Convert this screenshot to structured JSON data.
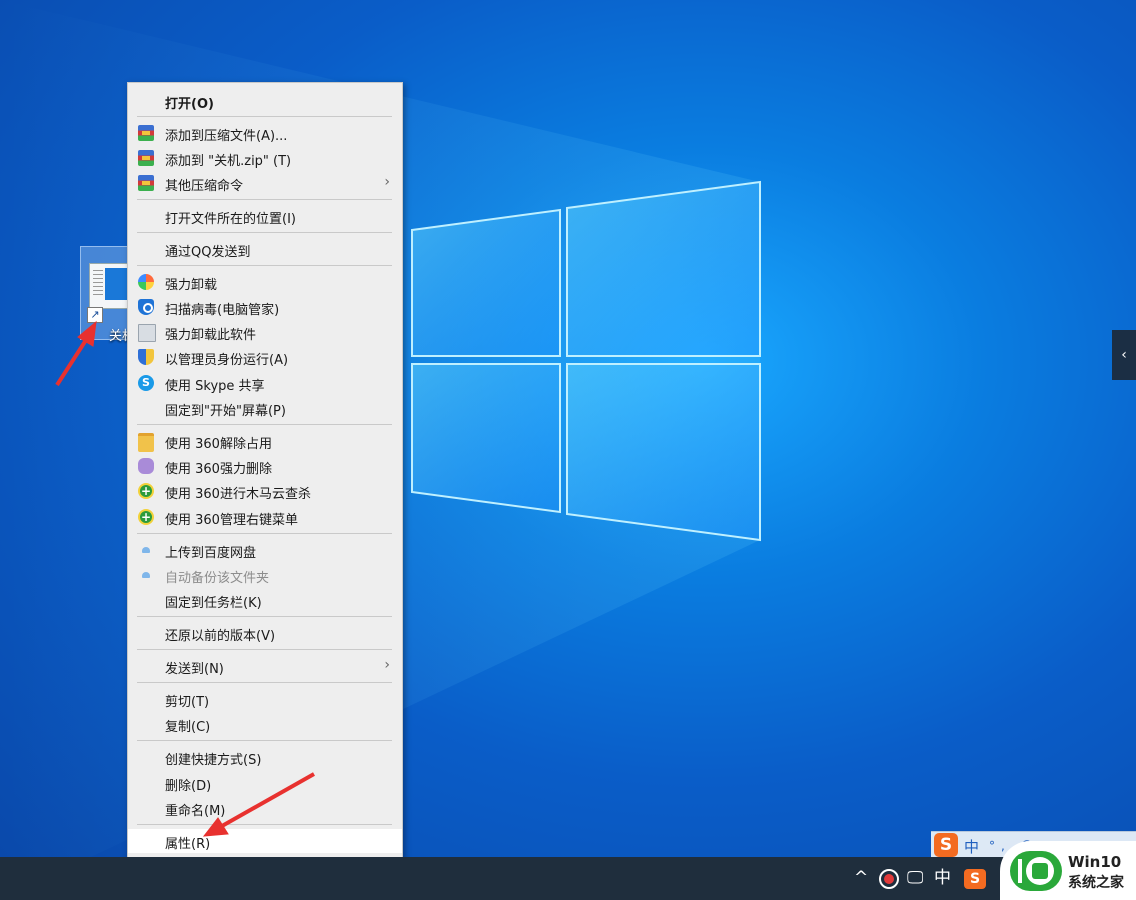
{
  "desktop": {
    "icon_label": "关机",
    "background_color": "#0a6ad6"
  },
  "context_menu": {
    "items": [
      {
        "label": "打开(O)",
        "bold": true,
        "icon": "none"
      },
      {
        "label": "添加到压缩文件(A)...",
        "icon": "winrar-icon"
      },
      {
        "label": "添加到 \"关机.zip\" (T)",
        "icon": "winrar-icon"
      },
      {
        "label": "其他压缩命令",
        "icon": "winrar-icon",
        "submenu": true
      },
      {
        "label": "打开文件所在的位置(I)",
        "icon": "none"
      },
      {
        "label": "通过QQ发送到",
        "icon": "none"
      },
      {
        "label": "强力卸载",
        "icon": "flower-icon"
      },
      {
        "label": "扫描病毒(电脑管家)",
        "icon": "shield-icon"
      },
      {
        "label": "强力卸载此软件",
        "icon": "recycle-bin-icon"
      },
      {
        "label": "以管理员身份运行(A)",
        "icon": "uac-shield-icon"
      },
      {
        "label": "使用 Skype 共享",
        "icon": "skype-icon"
      },
      {
        "label": "固定到\"开始\"屏幕(P)",
        "icon": "none"
      },
      {
        "label": "使用 360解除占用",
        "icon": "folder-icon"
      },
      {
        "label": "使用 360强力删除",
        "icon": "eraser-icon"
      },
      {
        "label": "使用 360进行木马云查杀",
        "icon": "360-icon"
      },
      {
        "label": "使用 360管理右键菜单",
        "icon": "360-icon"
      },
      {
        "label": "上传到百度网盘",
        "icon": "cloud-icon"
      },
      {
        "label": "自动备份该文件夹",
        "icon": "cloud-icon",
        "disabled": true
      },
      {
        "label": "固定到任务栏(K)",
        "icon": "none"
      },
      {
        "label": "还原以前的版本(V)",
        "icon": "none"
      },
      {
        "label": "发送到(N)",
        "icon": "none",
        "submenu": true
      },
      {
        "label": "剪切(T)",
        "icon": "none"
      },
      {
        "label": "复制(C)",
        "icon": "none"
      },
      {
        "label": "创建快捷方式(S)",
        "icon": "none"
      },
      {
        "label": "删除(D)",
        "icon": "none"
      },
      {
        "label": "重命名(M)",
        "icon": "none"
      },
      {
        "label": "属性(R)",
        "icon": "none",
        "hovered": true
      }
    ],
    "submenu_arrow": "›"
  },
  "side_tab": {
    "glyph": "‹"
  },
  "ime_bar": {
    "logo": "S",
    "mode": "中",
    "icons": "°, ☺ ♪ ▦ ✎"
  },
  "taskbar": {
    "tray_chevron": "^",
    "tray_monitor": "🖵",
    "tray_lang": "中",
    "tray_sogou": "S"
  },
  "watermark": {
    "line1": "Win10",
    "line2": "系统之家"
  },
  "colors": {
    "annotation_red": "#e8312f",
    "menu_bg": "#eeeeee",
    "taskbar": "#1f2e3d"
  }
}
